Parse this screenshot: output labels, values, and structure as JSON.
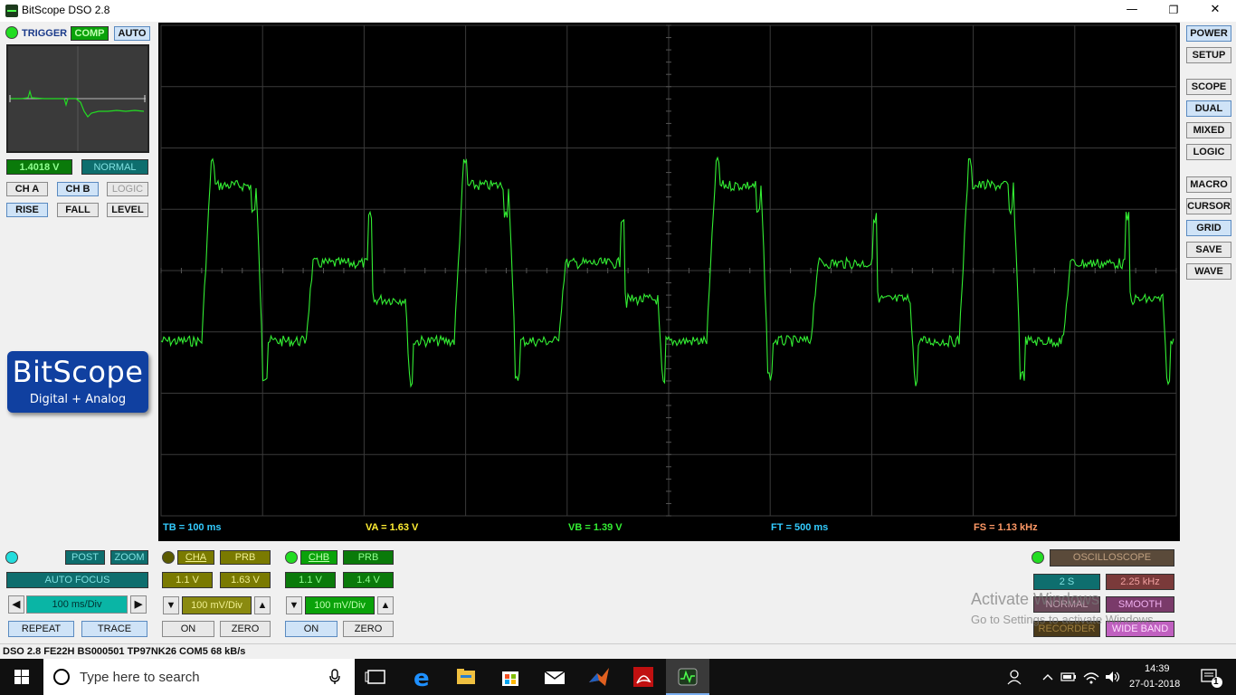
{
  "window": {
    "title": "BitScope DSO 2.8",
    "min": "—",
    "max": "❐",
    "close": "✕"
  },
  "trigger": {
    "label": "TRIGGER",
    "comp": "COMP",
    "auto": "AUTO",
    "voltage": "1.4018 V",
    "mode": "NORMAL",
    "ch_a": "CH A",
    "ch_b": "CH B",
    "logic": "LOGIC",
    "rise": "RISE",
    "fall": "FALL",
    "level": "LEVEL"
  },
  "logo": {
    "name": "BitScope",
    "tagline": "Digital + Analog"
  },
  "readouts": {
    "tb": "TB = 100 ms",
    "va": "VA = 1.63 V",
    "vb": "VB = 1.39 V",
    "ft": "FT = 500 ms",
    "fs": "FS = 1.13 kHz"
  },
  "timebase": {
    "post": "POST",
    "zoom": "ZOOM",
    "auto_focus": "AUTO FOCUS",
    "value": "100 ms/Div",
    "left_arrow": "◀",
    "right_arrow": "▶",
    "repeat": "REPEAT",
    "trace": "TRACE"
  },
  "channel_a": {
    "name": "CHA",
    "prb": "PRB",
    "offset": "1.1 V",
    "value": "1.63 V",
    "scale": "100 mV/Div",
    "down": "▼",
    "up": "▲",
    "on": "ON",
    "zero": "ZERO"
  },
  "channel_b": {
    "name": "CHB",
    "prb": "PRB",
    "offset": "1.1 V",
    "value": "1.4 V",
    "scale": "100 mV/Div",
    "down": "▼",
    "up": "▲",
    "on": "ON",
    "zero": "ZERO"
  },
  "capture": {
    "mode": "OSCILLOSCOPE",
    "duration": "2 S",
    "rate": "2.25 kHz",
    "normal": "NORMAL",
    "smooth": "SMOOTH",
    "recorder": "RECORDER",
    "wideband": "WIDE BAND"
  },
  "right_panel": [
    "POWER",
    "SETUP",
    "SCOPE",
    "DUAL",
    "MIXED",
    "LOGIC",
    "MACRO",
    "CURSOR",
    "GRID",
    "SAVE",
    "WAVE"
  ],
  "status": "DSO 2.8 FE22H BS000501 TP97NK26 COM5 68 kB/s",
  "watermark": {
    "line1": "Activate Windows",
    "line2": "Go to Settings to activate Windows."
  },
  "taskbar": {
    "search_placeholder": "Type here to search",
    "time": "14:39",
    "date": "27-01-2018",
    "notifications": "1"
  },
  "colors": {
    "trace": "#33ee33",
    "grid": "#3a3a3a",
    "tb": "#33ccff",
    "va": "#ffee33",
    "vb": "#33ee33",
    "ft": "#33ccff",
    "fs": "#ff9966"
  }
}
